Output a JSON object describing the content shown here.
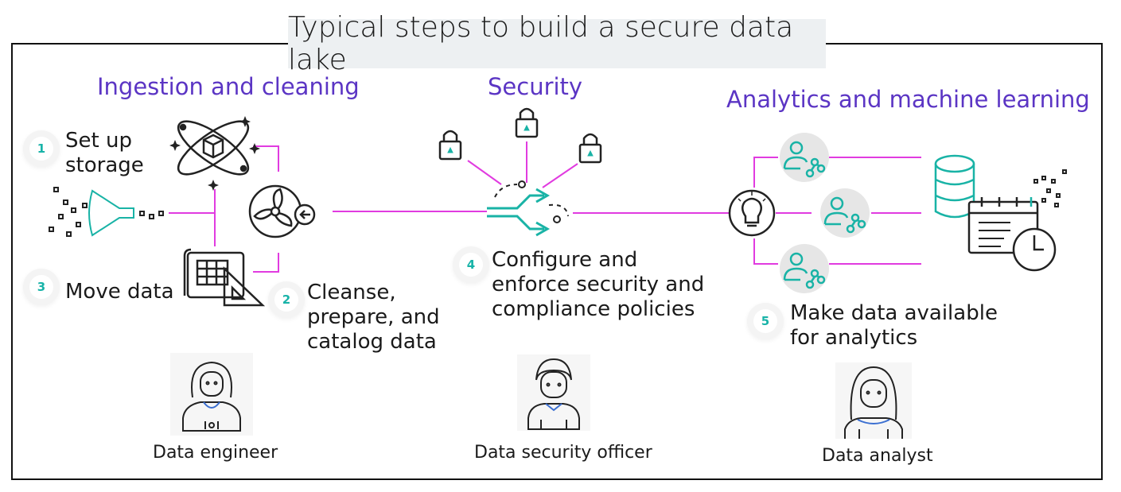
{
  "title": "Typical steps to build a secure data lake",
  "sections": {
    "ingestion": "Ingestion and cleaning",
    "security": "Security",
    "analytics": "Analytics and machine learning"
  },
  "steps": [
    {
      "number": "1",
      "line1": "Set up",
      "line2": "storage",
      "line3": ""
    },
    {
      "number": "2",
      "line1": "Cleanse,",
      "line2": "prepare, and",
      "line3": "catalog data"
    },
    {
      "number": "3",
      "line1": "Move data",
      "line2": "",
      "line3": ""
    },
    {
      "number": "4",
      "line1": "Configure and",
      "line2": "enforce security and",
      "line3": "compliance policies"
    },
    {
      "number": "5",
      "line1": "Make data available",
      "line2": "for analytics",
      "line3": ""
    }
  ],
  "roles": {
    "engineer": "Data engineer",
    "security_officer": "Data security officer",
    "analyst": "Data analyst"
  },
  "colors": {
    "connector": "#e13be0",
    "section_heading": "#5b35c4",
    "badge_number": "#18b3a8",
    "teal_icon": "#19b3a6",
    "title_background": "#edf0f2"
  },
  "icons": [
    "atom-cube-icon",
    "funnel-icon",
    "blueprint-icon",
    "fan-icon",
    "lock-icon",
    "merge-arrows-icon",
    "lightbulb-icon",
    "user-network-icon",
    "database-icon",
    "calendar-clock-icon",
    "engineer-avatar-icon",
    "security-officer-avatar-icon",
    "analyst-avatar-icon"
  ]
}
